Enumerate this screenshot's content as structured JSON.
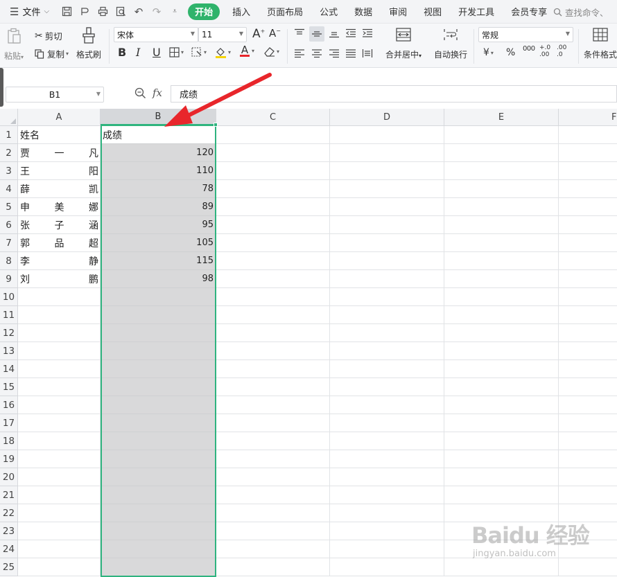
{
  "menubar": {
    "file_label": "文件",
    "tabs": [
      "开始",
      "插入",
      "页面布局",
      "公式",
      "数据",
      "审阅",
      "视图",
      "开发工具",
      "会员专享"
    ],
    "search_placeholder": "查找命令、"
  },
  "ribbon": {
    "paste": "粘贴",
    "cut": "剪切",
    "copy": "复制",
    "format_painter": "格式刷",
    "font_name": "宋体",
    "font_size": "11",
    "merge_center": "合并居中",
    "wrap_text": "自动换行",
    "number_format": "常规",
    "currency_symbol": "¥",
    "percent_symbol": "%",
    "thousands": "000",
    "conditional_format": "条件格式",
    "bold": "B",
    "italic": "I",
    "underline": "U",
    "font_grow": "A",
    "font_shrink": "A",
    "font_color": "A",
    "decimal_inc": ".00",
    "decimal_dec": ".0"
  },
  "formula_bar": {
    "name_box": "B1",
    "fx": "fx",
    "content": "成绩"
  },
  "grid": {
    "columns": [
      "A",
      "B",
      "C",
      "D",
      "E",
      "F"
    ],
    "selected_column": "B",
    "rows": [
      "1",
      "2",
      "3",
      "4",
      "5",
      "6",
      "7",
      "8",
      "9",
      "10",
      "11",
      "12",
      "13",
      "14",
      "15",
      "16",
      "17",
      "18",
      "19",
      "20",
      "21",
      "22",
      "23",
      "24",
      "25"
    ],
    "header_row": {
      "A": "姓名",
      "B": "成绩"
    },
    "data": [
      {
        "name": [
          "贾",
          "一",
          "凡"
        ],
        "score": "120"
      },
      {
        "name": [
          "王",
          "",
          "阳"
        ],
        "score": "110"
      },
      {
        "name": [
          "薛",
          "",
          "凯"
        ],
        "score": "78"
      },
      {
        "name": [
          "申",
          "美",
          "娜"
        ],
        "score": "89"
      },
      {
        "name": [
          "张",
          "子",
          "涵"
        ],
        "score": "95"
      },
      {
        "name": [
          "郭",
          "品",
          "超"
        ],
        "score": "105"
      },
      {
        "name": [
          "李",
          "",
          "静"
        ],
        "score": "115"
      },
      {
        "name": [
          "刘",
          "",
          "鹏"
        ],
        "score": "98"
      }
    ]
  },
  "watermark": {
    "main": "Baidu 经验",
    "sub": "jingyan.baidu.com"
  },
  "colors": {
    "accent": "#2fb36b",
    "selection_border": "#2fb37f",
    "selection_fill": "#d9d9da",
    "arrow": "#e8262b"
  }
}
